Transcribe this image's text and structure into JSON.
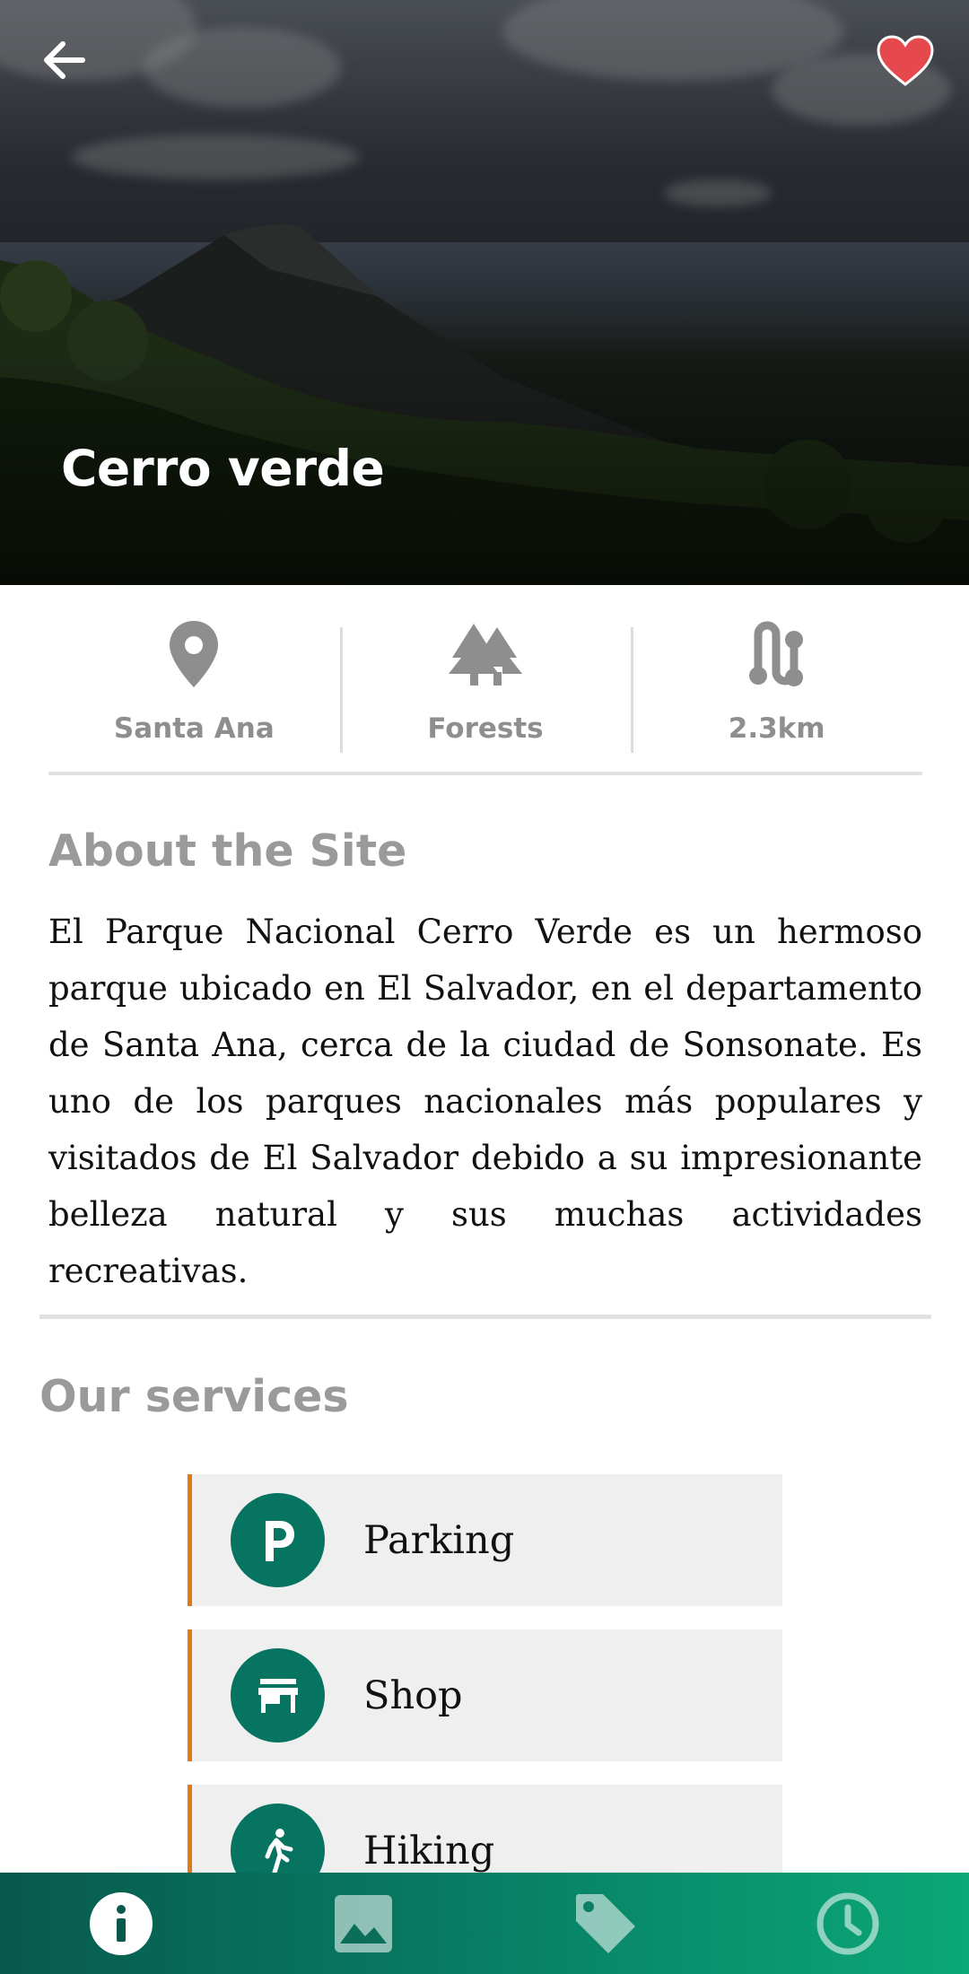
{
  "header": {
    "title": "Cerro verde",
    "back_icon": "arrow-left-icon",
    "favorite_icon": "heart-icon",
    "favorite_color": "#e5484d"
  },
  "info": [
    {
      "icon": "location-pin-icon",
      "label": "Santa Ana"
    },
    {
      "icon": "trees-icon",
      "label": "Forests"
    },
    {
      "icon": "route-icon",
      "label": "2.3km"
    }
  ],
  "about": {
    "title": "About the Site",
    "text": "El Parque Nacional Cerro Verde es un hermoso parque ubicado en El Salvador, en el departamento de Santa Ana, cerca de la ciudad de Sonsonate. Es uno de los parques nacionales más populares y visitados de El Salvador debido a su impresionante belleza natural y sus muchas actividades recreativas."
  },
  "services": {
    "title": "Our services",
    "items": [
      {
        "icon": "parking-icon",
        "label": "Parking"
      },
      {
        "icon": "store-icon",
        "label": "Shop"
      },
      {
        "icon": "hiking-icon",
        "label": "Hiking"
      }
    ],
    "accent_color": "#e07a18",
    "icon_bg_color": "#067461"
  },
  "bottom_nav": {
    "items": [
      {
        "icon": "info-icon",
        "active": true
      },
      {
        "icon": "image-icon",
        "active": false
      },
      {
        "icon": "tag-icon",
        "active": false
      },
      {
        "icon": "clock-icon",
        "active": false
      }
    ]
  }
}
